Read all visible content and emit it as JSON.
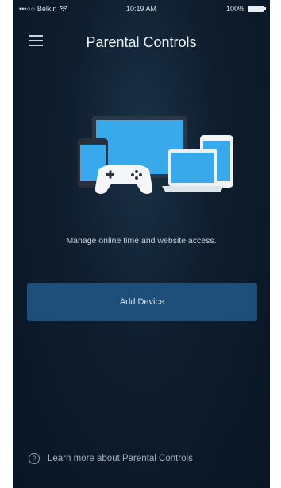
{
  "status_bar": {
    "carrier": "•••○○ Belkin",
    "wifi_icon": "wifi-icon",
    "time": "10:19 AM",
    "battery": "100%"
  },
  "header": {
    "menu_icon": "hamburger-menu-icon",
    "title": "Parental Controls"
  },
  "hero": {
    "illustration": "devices-illustration"
  },
  "main": {
    "description": "Manage online time and website access.",
    "add_device_label": "Add Device"
  },
  "footer": {
    "help_icon": "question-circle-icon",
    "help_icon_glyph": "?",
    "help_link": "Learn more about Parental Controls"
  },
  "colors": {
    "background": "#0e1c2c",
    "button": "#1d4f7a",
    "text": "#e6edf3"
  }
}
